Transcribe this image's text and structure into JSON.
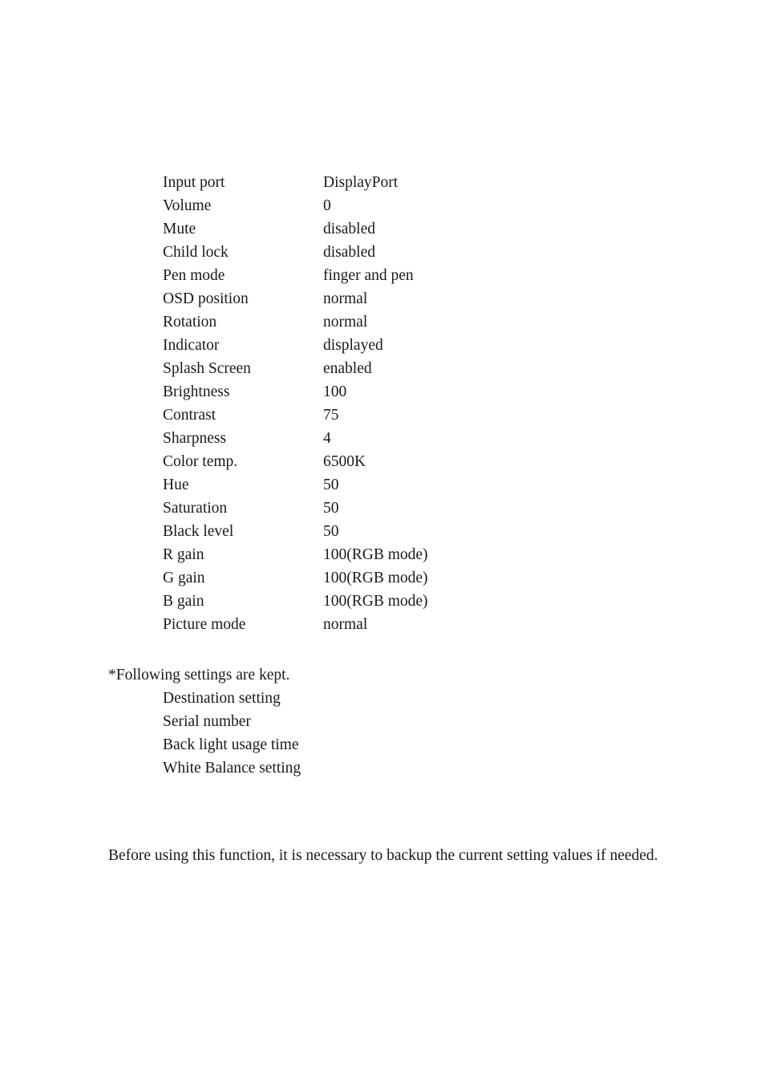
{
  "document": {
    "settings_table": {
      "rows": [
        {
          "label": "Input port",
          "value": "DisplayPort"
        },
        {
          "label": "Volume",
          "value": "0"
        },
        {
          "label": "Mute",
          "value": "disabled"
        },
        {
          "label": "Child lock",
          "value": "disabled"
        },
        {
          "label": "Pen mode",
          "value": "finger and pen"
        },
        {
          "label": "OSD position",
          "value": "normal"
        },
        {
          "label": "Rotation",
          "value": "normal"
        },
        {
          "label": "Indicator",
          "value": "displayed"
        },
        {
          "label": "Splash Screen",
          "value": "enabled"
        },
        {
          "label": "Brightness",
          "value": "100"
        },
        {
          "label": "Contrast",
          "value": "75"
        },
        {
          "label": "Sharpness",
          "value": "4"
        },
        {
          "label": "Color temp.",
          "value": "6500K"
        },
        {
          "label": "Hue",
          "value": "50"
        },
        {
          "label": "Saturation",
          "value": "50"
        },
        {
          "label": "Black level",
          "value": "50"
        },
        {
          "label": "R gain",
          "value": "100(RGB mode)"
        },
        {
          "label": "G gain",
          "value": "100(RGB mode)"
        },
        {
          "label": "B gain",
          "value": "100(RGB mode)"
        },
        {
          "label": "Picture mode",
          "value": "normal"
        }
      ]
    },
    "kept_settings": {
      "note": "*Following settings are kept.",
      "items": [
        "Destination setting",
        "Serial number",
        "Back light usage time",
        "White Balance setting"
      ]
    },
    "footer_note": "Before using this function, it is necessary to backup the current setting values if needed.",
    "colors": {
      "text": "#1a1a1a",
      "background": "#ffffff"
    }
  }
}
